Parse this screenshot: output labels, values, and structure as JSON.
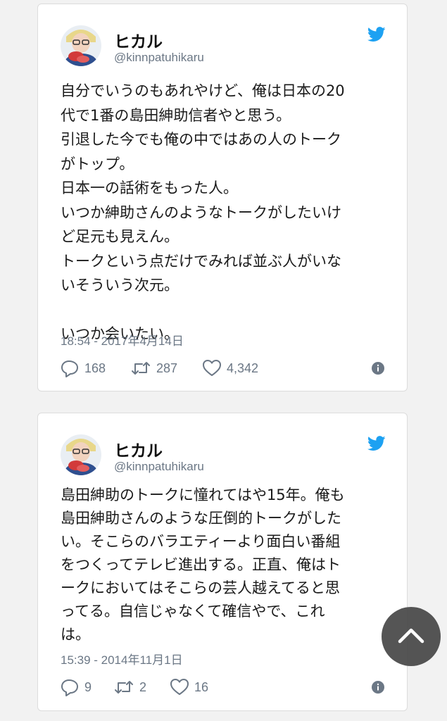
{
  "colors": {
    "page_bg": "#f2f2f2",
    "card_bg": "#ffffff",
    "twitter_blue": "#1da1f2",
    "meta_gray": "#6b7785",
    "scroll_button": "#464646"
  },
  "tweets": [
    {
      "display_name": "ヒカル",
      "handle": "@kinnpatuhikaru",
      "text": "自分でいうのもあれやけど、俺は日本の20\n代で1番の島田紳助信者やと思う。\n引退した今でも俺の中ではあの人のトーク\nがトップ。\n日本一の話術をもった人。\nいつか紳助さんのようなトークがしたいけ\nど足元も見えん。\nトークという点だけでみれば並ぶ人がいな\nいそういう次元。\n\nいつか会いたい。",
      "timestamp": "18:54 - 2017年4月14日",
      "replies": "168",
      "retweets": "287",
      "likes": "4,342"
    },
    {
      "display_name": "ヒカル",
      "handle": "@kinnpatuhikaru",
      "text": "島田紳助のトークに憧れてはや15年。俺も\n島田紳助さんのような圧倒的トークがした\nい。そこらのバラエティーより面白い番組\nをつくってテレビ進出する。正直、俺はト\nークにおいてはそこらの芸人越えてると思\nってる。自信じゃなくて確信やで、これ\nは。",
      "timestamp": "15:39 - 2014年11月1日",
      "replies": "9",
      "retweets": "2",
      "likes": "16"
    }
  ],
  "icons": {
    "bird": "twitter-bird-icon",
    "reply": "reply-icon",
    "retweet": "retweet-icon",
    "like": "heart-icon",
    "info": "info-icon",
    "scroll_top": "chevron-up-icon"
  }
}
